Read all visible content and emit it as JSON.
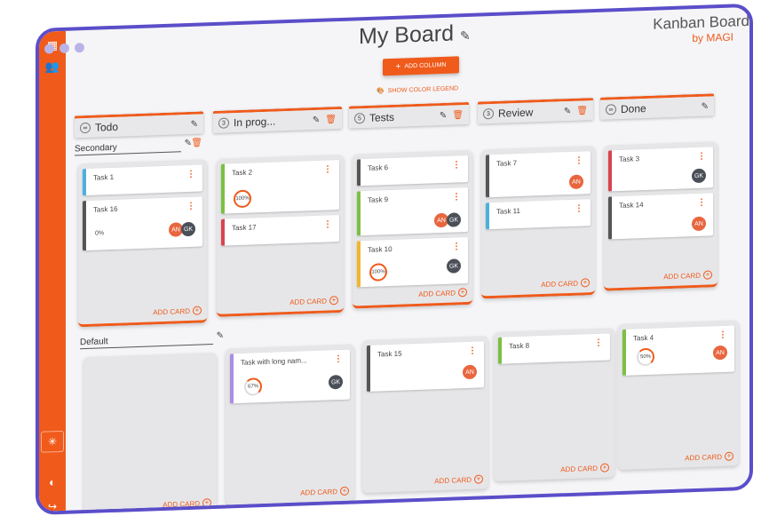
{
  "sidebar": {
    "icons": [
      "dashboard-icon",
      "people-icon"
    ],
    "language_flag": "uk-flag-icon"
  },
  "header": {
    "title": "My Board",
    "brand": "Kanban Board",
    "brand_sub": "by MAGI",
    "add_column": "ADD COLUMN",
    "color_legend": "SHOW COLOR LEGEND"
  },
  "columns": [
    {
      "label": "Todo",
      "count": "∞"
    },
    {
      "label": "In prog...",
      "count": "3"
    },
    {
      "label": "Tests",
      "count": "5"
    },
    {
      "label": "Review",
      "count": "3"
    },
    {
      "label": "Done",
      "count": "∞"
    }
  ],
  "swimlanes": [
    {
      "label": "Secondary"
    },
    {
      "label": "Default"
    }
  ],
  "add_card": "ADD CARD",
  "cards": {
    "task1": {
      "title": "Task 1"
    },
    "task16": {
      "title": "Task 16",
      "progress": "0%",
      "avatars": [
        "AN",
        "GK"
      ]
    },
    "task2": {
      "title": "Task 2",
      "progress": "100%"
    },
    "task17": {
      "title": "Task 17"
    },
    "task6": {
      "title": "Task 6"
    },
    "task9": {
      "title": "Task 9",
      "avatars": [
        "AN",
        "GK"
      ]
    },
    "task10": {
      "title": "Task 10",
      "progress": "100%",
      "avatars": [
        "GK"
      ]
    },
    "task7": {
      "title": "Task 7",
      "avatars": [
        "AN"
      ]
    },
    "task11": {
      "title": "Task 11"
    },
    "task3": {
      "title": "Task 3",
      "avatars": [
        "GK"
      ]
    },
    "task14": {
      "title": "Task 14",
      "avatars": [
        "AN"
      ]
    },
    "tasklong": {
      "title": "Task with long nam...",
      "progress": "67%",
      "avatars": [
        "GK"
      ]
    },
    "task15": {
      "title": "Task 15",
      "avatars": [
        "AN"
      ]
    },
    "task8": {
      "title": "Task 8"
    },
    "task4": {
      "title": "Task 4",
      "progress": "50%",
      "avatars": [
        "AN"
      ]
    }
  },
  "colors": {
    "accent": "#f05a1a",
    "frame": "#5b4ec9"
  }
}
